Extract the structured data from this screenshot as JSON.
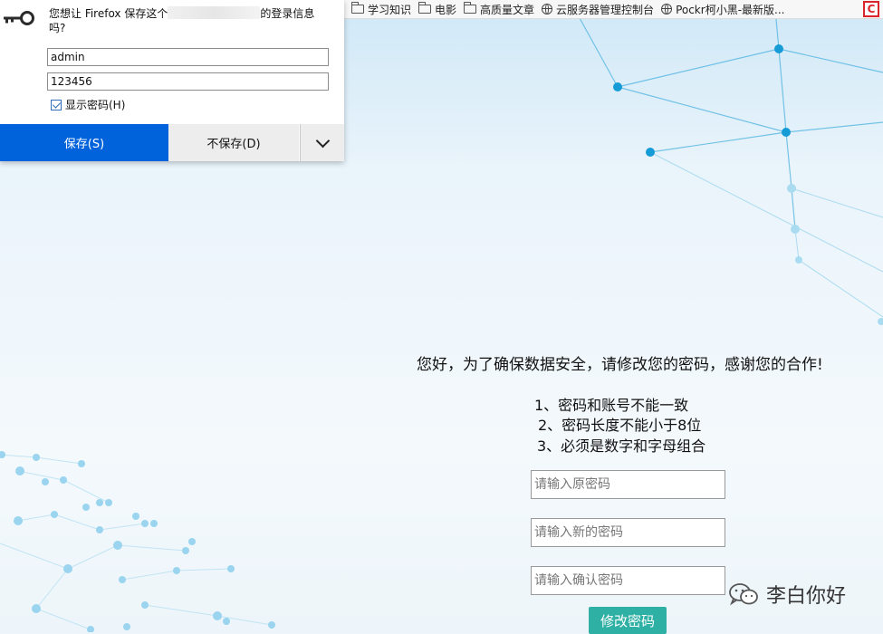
{
  "bookmarks": {
    "items": [
      {
        "label": "学习知识",
        "icon": "folder-icon"
      },
      {
        "label": "电影",
        "icon": "folder-icon"
      },
      {
        "label": "高质量文章",
        "icon": "folder-icon"
      },
      {
        "label": "云服务器管理控制台",
        "icon": "globe-icon"
      },
      {
        "label": "Pockr柯小黑-最新版...",
        "icon": "globe-icon"
      }
    ],
    "csdn_letter": "C"
  },
  "password_dialog": {
    "message_prefix": "您想让 Firefox 保存这个",
    "message_suffix": "的登录信息",
    "message_line2": "吗?",
    "username": "admin",
    "password": "123456",
    "show_password_label": "显示密码(H)",
    "show_password_checked": true,
    "save_label": "保存(S)",
    "dont_save_label": "不保存(D)"
  },
  "form": {
    "notice": "您好，为了确保数据安全，请修改您的密码，感谢您的合作!",
    "rules": [
      "1、密码和账号不能一致",
      "2、密码长度不能小于8位",
      "3、必须是数字和字母组合"
    ],
    "old_password_placeholder": "请输入原密码",
    "new_password_placeholder": "请输入新的密码",
    "confirm_password_placeholder": "请输入确认密码",
    "submit_label": "修改密码"
  },
  "watermark": {
    "text": "李白你好"
  },
  "colors": {
    "save_button": "#0063dc",
    "submit_button": "#2fb0a4",
    "csdn_red": "#d9252a"
  }
}
